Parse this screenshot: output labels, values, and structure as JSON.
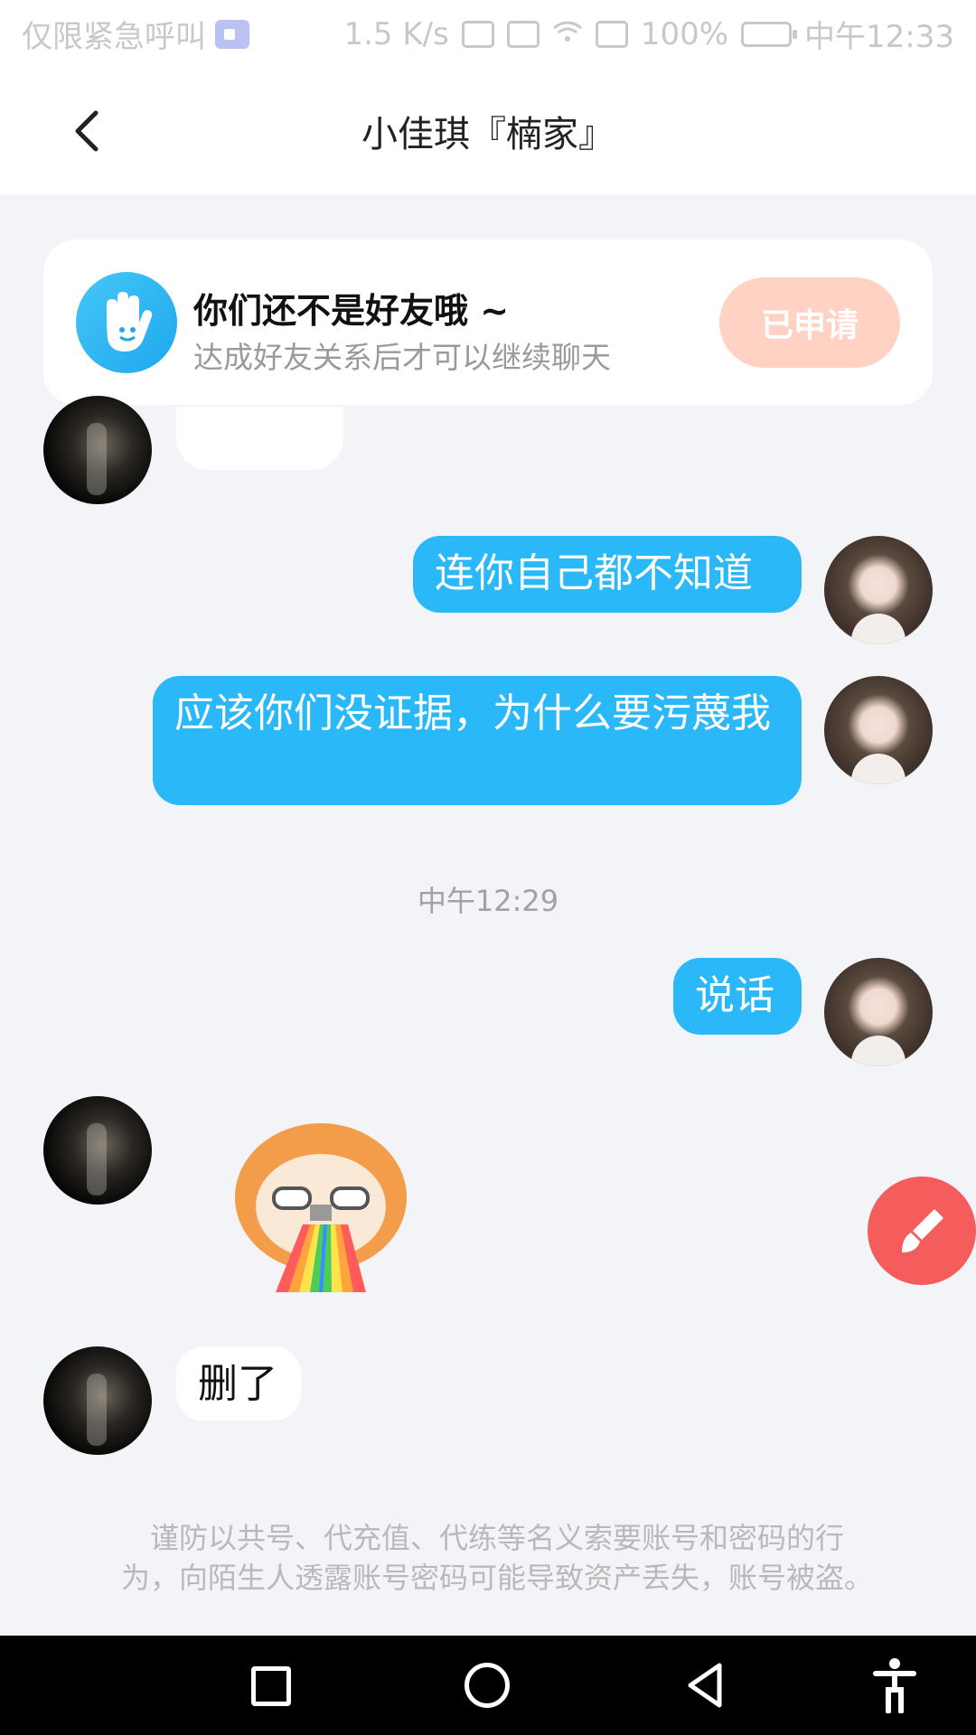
{
  "status_bar": {
    "carrier": "仅限紧急呼叫",
    "speed": "1.5 K/s",
    "battery": "100%",
    "time": "中午12:33"
  },
  "header": {
    "title": "小佳琪『楠家』"
  },
  "friend_notice": {
    "title": "你们还不是好友哦 ~",
    "subtitle": "达成好友关系后才可以继续聊天",
    "button_label": "已申请"
  },
  "messages": {
    "out_1": "连你自己都不知道",
    "out_2": "应该你们没证据，为什么要污蔑我",
    "timestamp": "中午12:29",
    "out_3": "说话",
    "in_2": "删了"
  },
  "warning": {
    "line1": "谨防以共号、代充值、代练等名义索要账号和密码的行",
    "line2": "为，向陌生人透露账号密码可能导致资产丢失，账号被盗。"
  },
  "colors": {
    "accent": "#2bb8f9",
    "apply_button": "#ffd2c3",
    "fab": "#f55c5c"
  },
  "icons": {
    "back": "back-arrow-icon",
    "friend_notice": "hand-icon",
    "fab": "brush-icon"
  }
}
